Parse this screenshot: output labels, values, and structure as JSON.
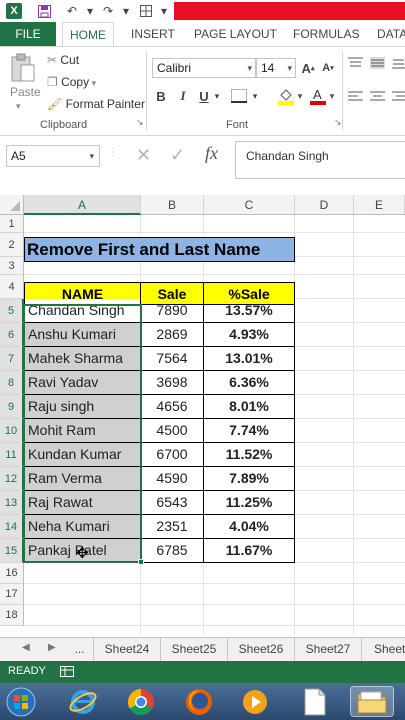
{
  "ribbon_tabs": [
    "FILE",
    "HOME",
    "INSERT",
    "PAGE LAYOUT",
    "FORMULAS",
    "DATA"
  ],
  "clipboard": {
    "paste": "Paste",
    "cut": "Cut",
    "copy": "Copy",
    "format_painter": "Format Painter",
    "group": "Clipboard"
  },
  "font": {
    "name": "Calibri",
    "size": "14",
    "group": "Font",
    "bold": "B",
    "italic": "I",
    "underline": "U"
  },
  "name_box": "A5",
  "formula": "Chandan Singh",
  "fx": "fx",
  "columns": [
    "A",
    "B",
    "C",
    "D",
    "E"
  ],
  "rows": [
    "1",
    "2",
    "3",
    "4",
    "5",
    "6",
    "7",
    "8",
    "9",
    "10",
    "11",
    "12",
    "13",
    "14",
    "15",
    "16",
    "17",
    "18"
  ],
  "sheet": {
    "title": "Remove First and Last Name",
    "headers": [
      "NAME",
      "Sale",
      "%Sale"
    ],
    "data": [
      [
        "Chandan Singh",
        "7890",
        "13.57%"
      ],
      [
        "Anshu Kumari",
        "2869",
        "4.93%"
      ],
      [
        "Mahek Sharma",
        "7564",
        "13.01%"
      ],
      [
        "Ravi Yadav",
        "3698",
        "6.36%"
      ],
      [
        "Raju singh",
        "4656",
        "8.01%"
      ],
      [
        "Mohit Ram",
        "4500",
        "7.74%"
      ],
      [
        "Kundan Kumar",
        "6700",
        "11.52%"
      ],
      [
        "Ram Verma",
        "4590",
        "7.89%"
      ],
      [
        "Raj Rawat",
        "6543",
        "11.25%"
      ],
      [
        "Neha Kumari",
        "2351",
        "4.04%"
      ],
      [
        "Pankaj Patel",
        "6785",
        "11.67%"
      ]
    ]
  },
  "sheet_tabs": [
    "...",
    "Sheet24",
    "Sheet25",
    "Sheet26",
    "Sheet27",
    "Sheet"
  ],
  "status": "READY",
  "colors": {
    "excel_green": "#217346",
    "title_fill": "#8db4e2",
    "header_fill": "#ffff00",
    "selection": "#d0d0d0",
    "close_red": "#e81123"
  }
}
